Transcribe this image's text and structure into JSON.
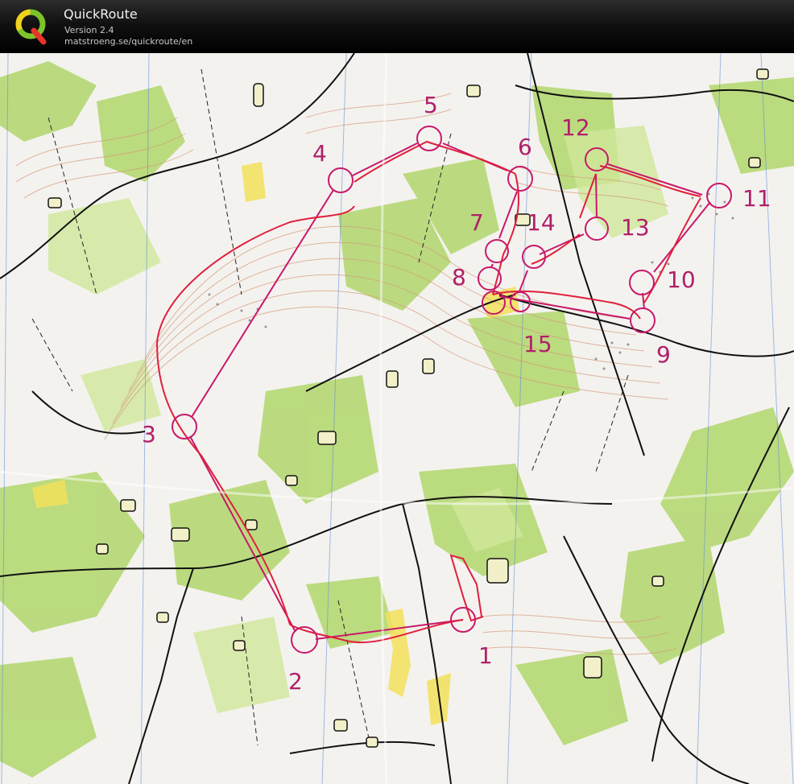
{
  "app": {
    "name": "QuickRoute",
    "version": "Version 2.4",
    "url": "matstroeng.se/quickroute/en"
  },
  "colors": {
    "course": "#c8186a",
    "route": "#e01f3d",
    "vegetation": "#9fcf4a",
    "open_land": "#f2e15a",
    "contours": "#d49a7a",
    "tracks": "#111111",
    "meridians": "#5a8ad8"
  },
  "map": {
    "controls": [
      {
        "label": "1"
      },
      {
        "label": "2"
      },
      {
        "label": "3"
      },
      {
        "label": "4"
      },
      {
        "label": "5"
      },
      {
        "label": "6"
      },
      {
        "label": "7"
      },
      {
        "label": "8"
      },
      {
        "label": "9"
      },
      {
        "label": "10"
      },
      {
        "label": "11"
      },
      {
        "label": "12"
      },
      {
        "label": "13"
      },
      {
        "label": "14"
      },
      {
        "label": "15"
      }
    ]
  }
}
